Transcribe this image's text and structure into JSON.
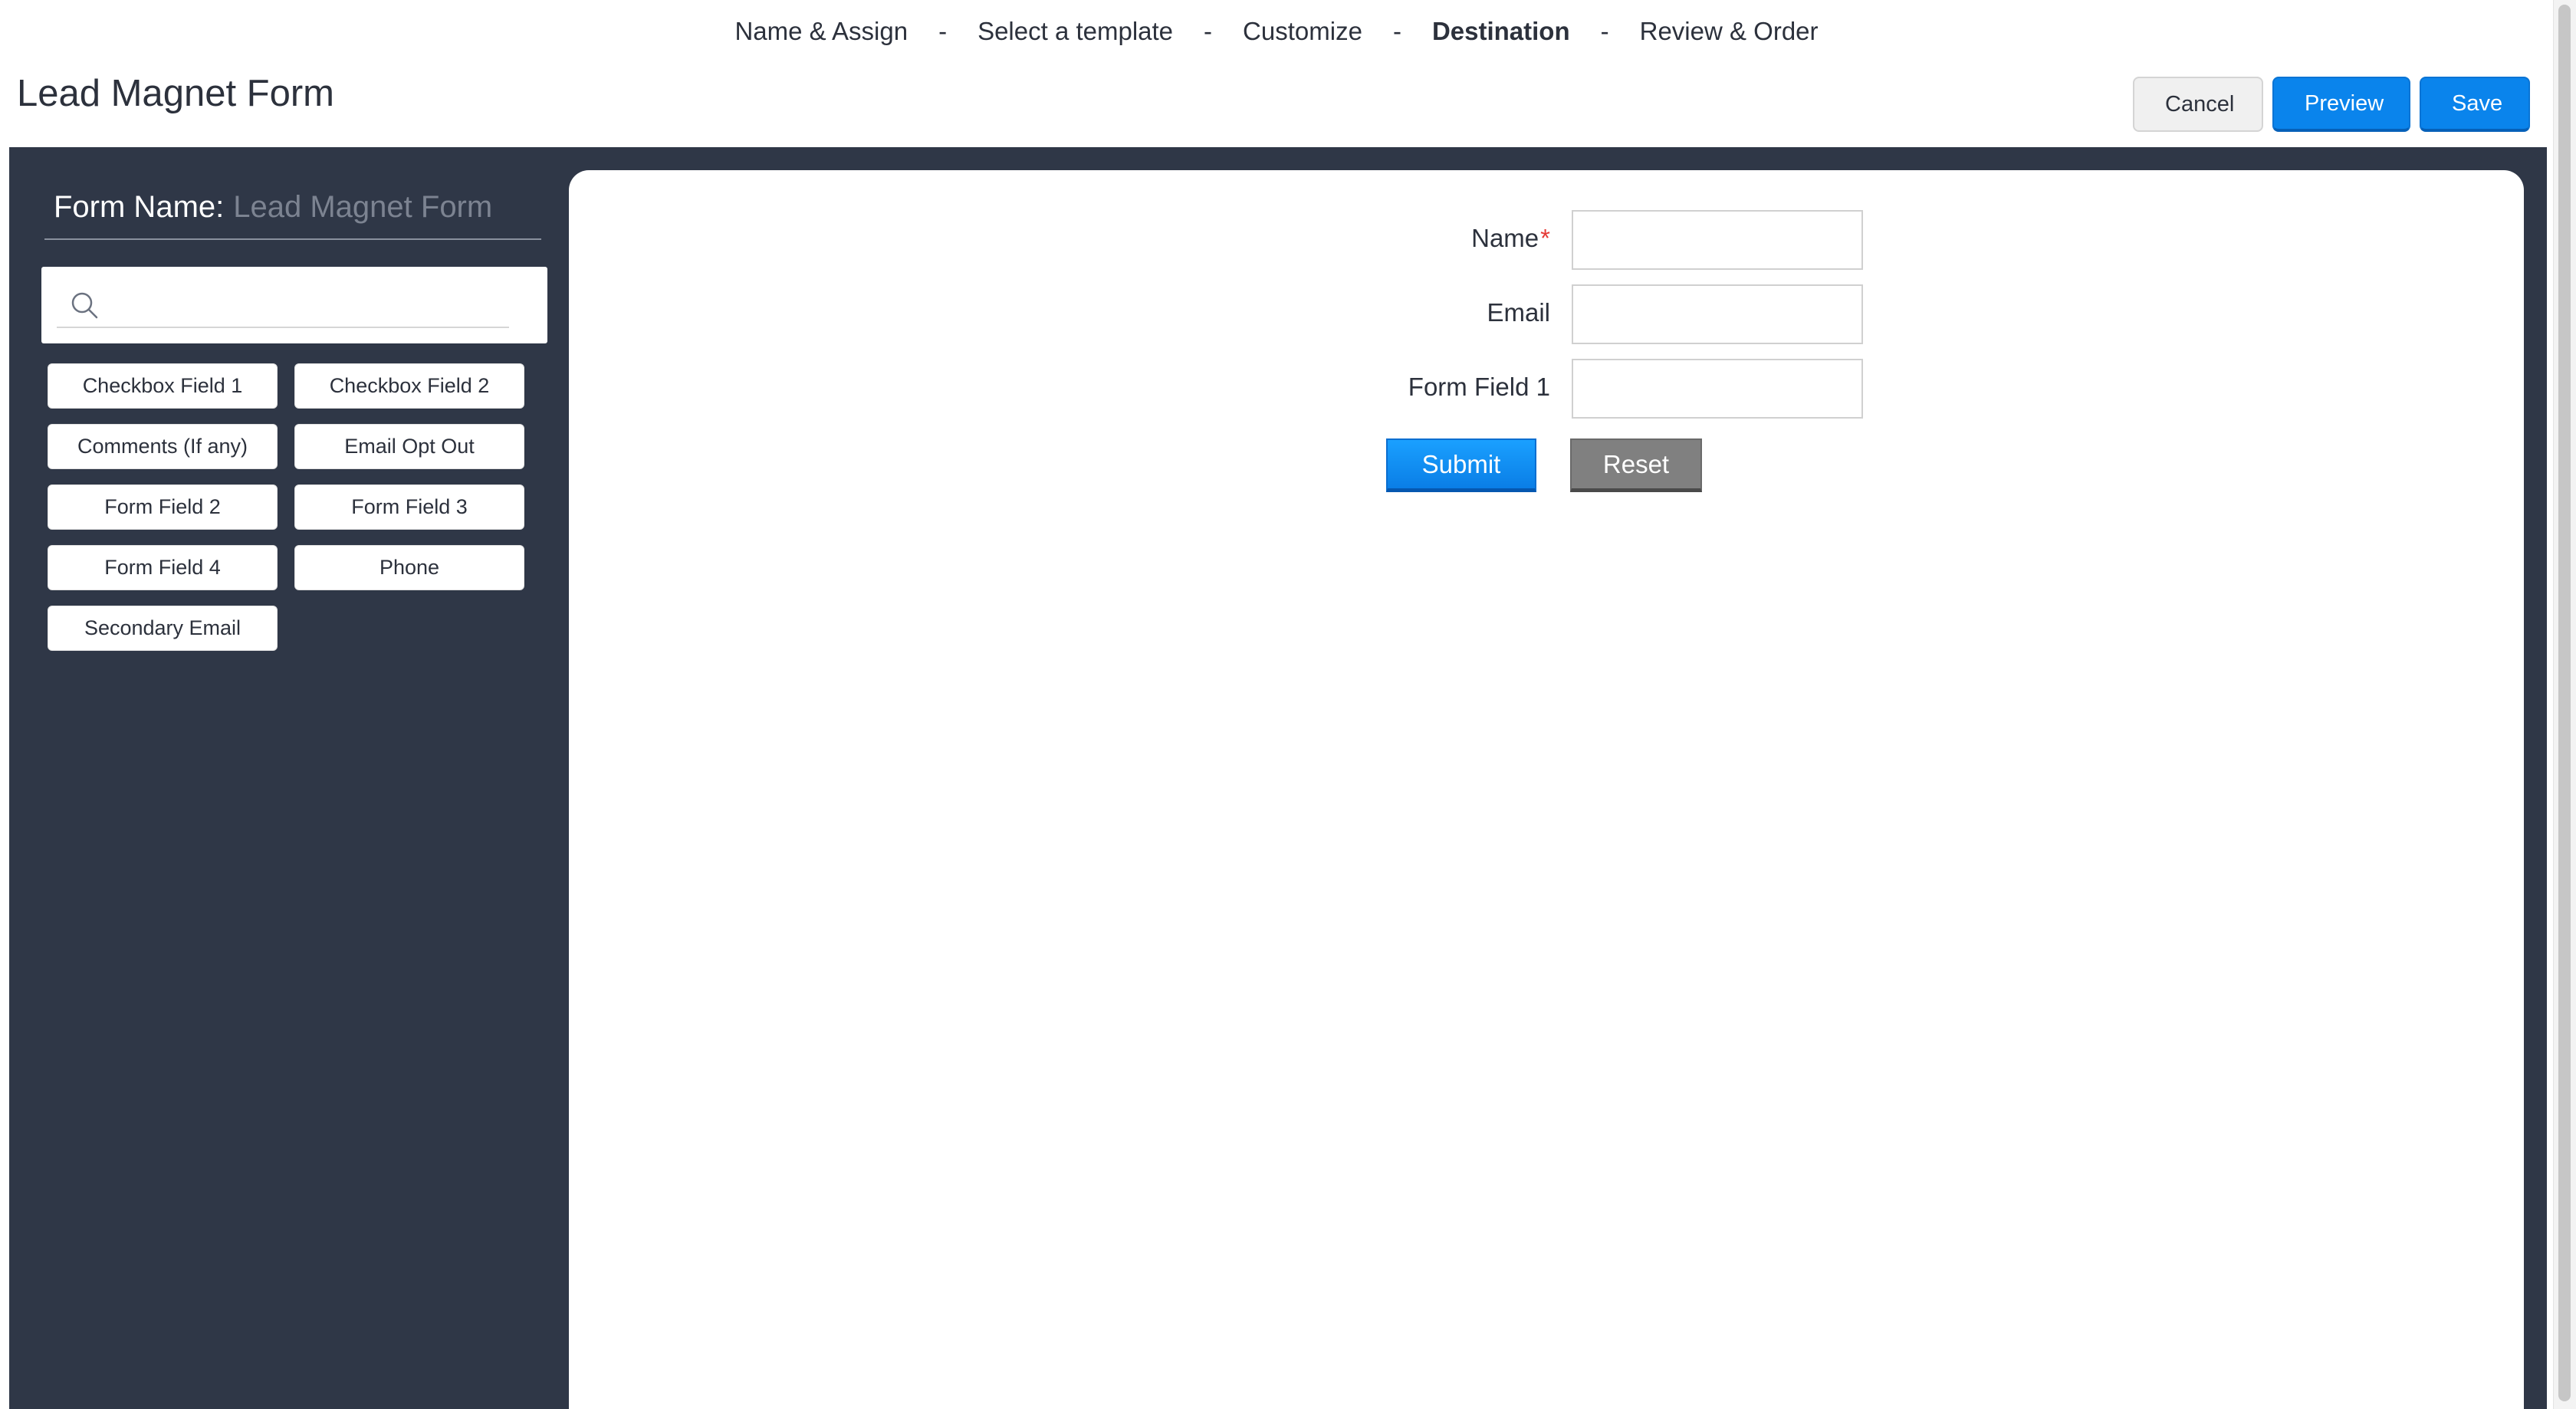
{
  "stepper": {
    "steps": [
      {
        "label": "Name & Assign",
        "active": false
      },
      {
        "label": "Select a template",
        "active": false
      },
      {
        "label": "Customize",
        "active": false
      },
      {
        "label": "Destination",
        "active": true
      },
      {
        "label": "Review & Order",
        "active": false
      }
    ],
    "separator": "-"
  },
  "header": {
    "title": "Lead Magnet Form",
    "cancel_label": "Cancel",
    "preview_label": "Preview",
    "save_label": "Save"
  },
  "sidebar": {
    "form_name_label": "Form Name:",
    "form_name_value": "Lead Magnet Form",
    "search": {
      "value": "",
      "placeholder": ""
    },
    "fields": [
      "Checkbox Field 1",
      "Checkbox Field 2",
      "Comments (If any)",
      "Email Opt Out",
      "Form Field 2",
      "Form Field 3",
      "Form Field 4",
      "Phone",
      "Secondary Email"
    ]
  },
  "form": {
    "fields": [
      {
        "label": "Name",
        "required": true,
        "value": ""
      },
      {
        "label": "Email",
        "required": false,
        "value": ""
      },
      {
        "label": "Form Field 1",
        "required": false,
        "value": ""
      }
    ],
    "required_marker": "*",
    "submit_label": "Submit",
    "reset_label": "Reset"
  },
  "colors": {
    "primary": "#0a84ec",
    "sidebar_bg": "#2f3747",
    "required": "#e53935",
    "reset": "#808080"
  }
}
